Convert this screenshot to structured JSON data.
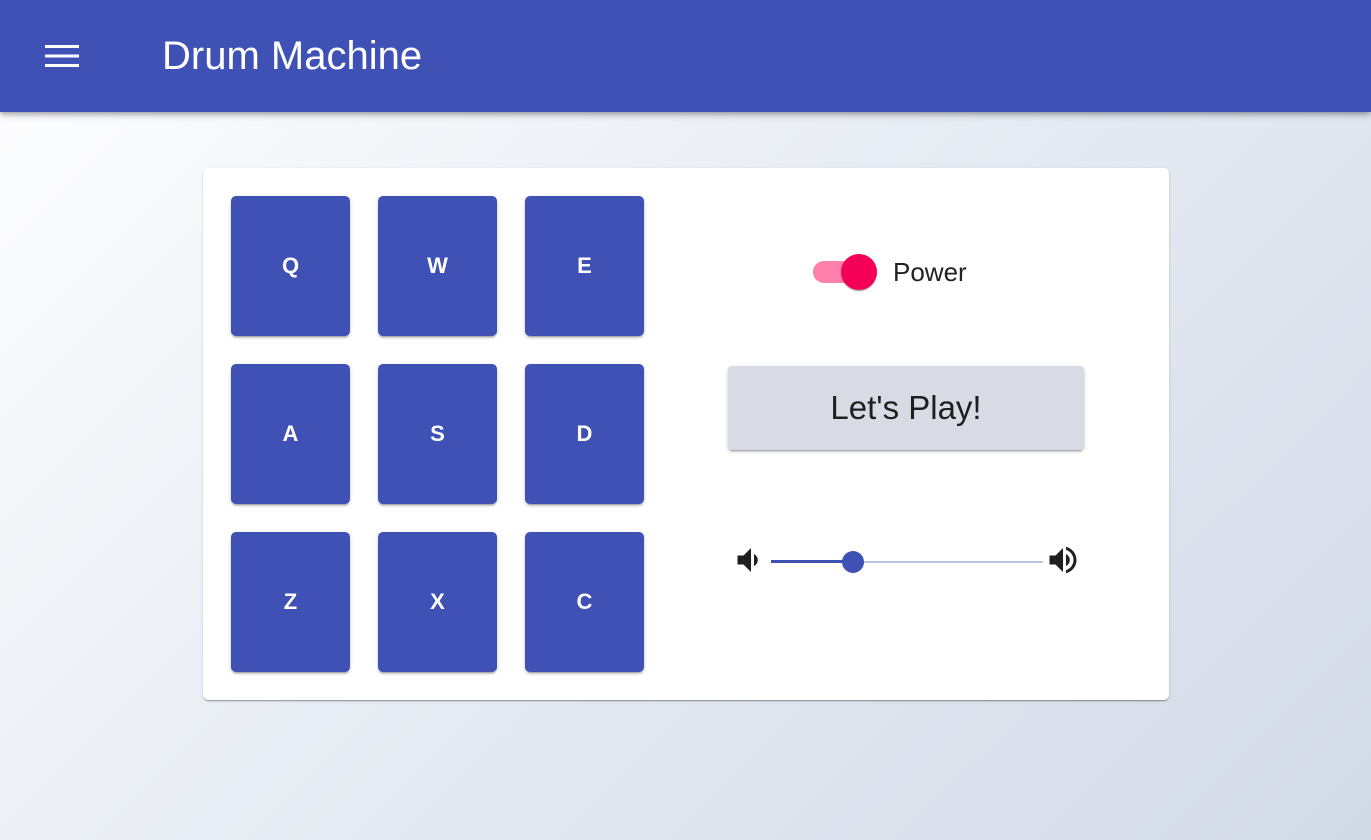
{
  "app_bar": {
    "title": "Drum Machine",
    "menu_icon": "hamburger-menu-icon",
    "color": "#3f51b5"
  },
  "drum_pads": [
    {
      "key": "Q"
    },
    {
      "key": "W"
    },
    {
      "key": "E"
    },
    {
      "key": "A"
    },
    {
      "key": "S"
    },
    {
      "key": "D"
    },
    {
      "key": "Z"
    },
    {
      "key": "X"
    },
    {
      "key": "C"
    }
  ],
  "power": {
    "label": "Power",
    "on": true,
    "track_color": "#ff80ab",
    "thumb_color": "#f50057"
  },
  "play_button": {
    "label": "Let's Play!"
  },
  "volume": {
    "low_icon": "volume-down-icon",
    "high_icon": "volume-up-icon",
    "value": 0.3
  }
}
